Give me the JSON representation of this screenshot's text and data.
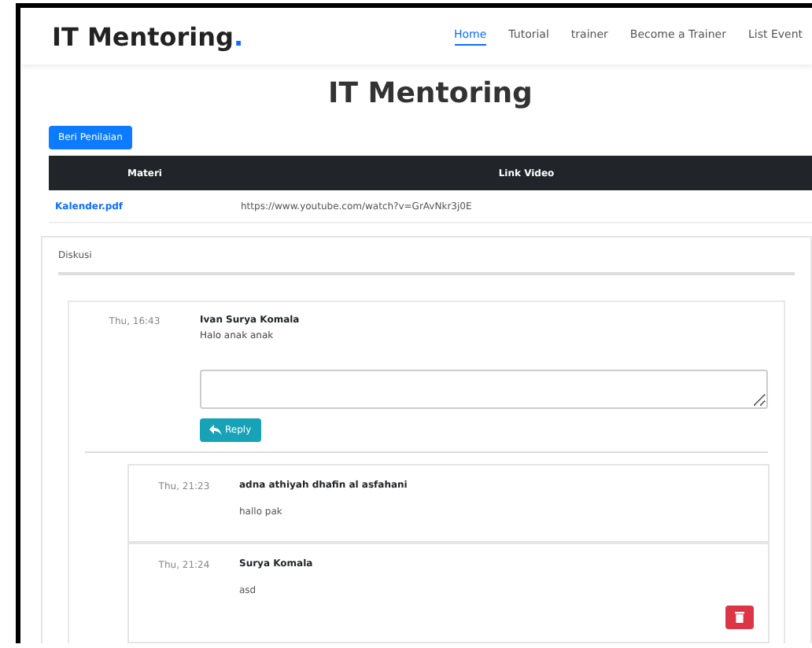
{
  "navbar": {
    "brand": "IT Mentoring",
    "brand_dot": ".",
    "links": [
      {
        "label": "Home",
        "selected": true
      },
      {
        "label": "Tutorial",
        "selected": false
      },
      {
        "label": "trainer",
        "selected": false
      },
      {
        "label": "Become a Trainer",
        "selected": false
      },
      {
        "label": "List Event",
        "selected": false
      }
    ]
  },
  "page_title": "IT Mentoring",
  "rate_button": "Beri Penilaian",
  "table": {
    "columns": [
      "Materi",
      "Link Video"
    ],
    "rows": [
      {
        "materi": "Kalender.pdf",
        "link_video": "https://www.youtube.com/watch?v=GrAvNkr3j0E"
      }
    ]
  },
  "discussion": {
    "heading": "Diskusi",
    "comments": [
      {
        "time": "Thu, 16:43",
        "author": "Ivan Surya Komala",
        "text": "Halo anak anak",
        "reply_button": "Reply",
        "replies": [
          {
            "time": "Thu, 21:23",
            "author": "adna athiyah dhafin al asfahani",
            "text": "hallo pak",
            "deletable": false
          },
          {
            "time": "Thu, 21:24",
            "author": "Surya Komala",
            "text": "asd",
            "deletable": true
          }
        ]
      }
    ]
  }
}
